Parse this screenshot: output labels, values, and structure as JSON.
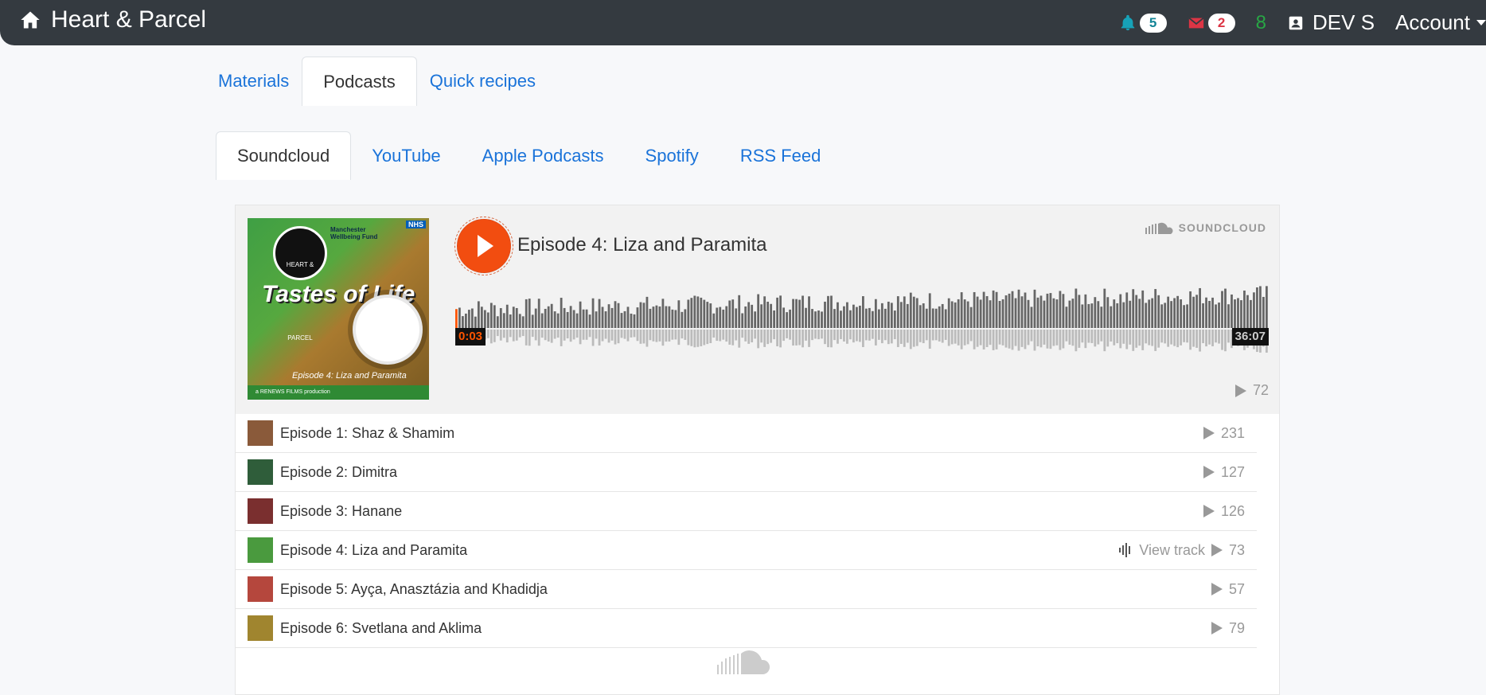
{
  "navbar": {
    "brand": "Heart & Parcel",
    "brand_icon": "home-icon",
    "notifications_count": "5",
    "messages_count": "2",
    "green_count": "8",
    "user_name": "DEV S",
    "account_label": "Account"
  },
  "main_tabs": [
    {
      "label": "Materials",
      "active": false
    },
    {
      "label": "Podcasts",
      "active": true
    },
    {
      "label": "Quick recipes",
      "active": false
    }
  ],
  "podcast_tabs": [
    {
      "label": "Soundcloud",
      "active": true
    },
    {
      "label": "YouTube",
      "active": false
    },
    {
      "label": "Apple Podcasts",
      "active": false
    },
    {
      "label": "Spotify",
      "active": false
    },
    {
      "label": "RSS Feed",
      "active": false
    }
  ],
  "player": {
    "current_track": "Episode 4: Liza and Paramita",
    "brand_label": "SOUNDCLOUD",
    "time_elapsed": "0:03",
    "time_total": "36:07",
    "plays": "72",
    "progress": 0.0014,
    "artwork": {
      "nhs": "NHS",
      "fund": "Manchester Wellbeing Fund",
      "logo": "HEART & PARCEL",
      "title": "Tastes of Life",
      "episode": "Episode 4:",
      "names": "Liza and Paramita",
      "footer": "a RENEWS FILMS production"
    }
  },
  "tracks": [
    {
      "title": "Episode 1: Shaz & Shamim",
      "plays": "231",
      "current": false,
      "thumb_color": "#8a5a3a"
    },
    {
      "title": "Episode 2: Dimitra",
      "plays": "127",
      "current": false,
      "thumb_color": "#2f5d3a"
    },
    {
      "title": "Episode 3: Hanane",
      "plays": "126",
      "current": false,
      "thumb_color": "#7a2f2f"
    },
    {
      "title": "Episode 4: Liza and Paramita",
      "plays": "73",
      "current": true,
      "view_label": "View track",
      "thumb_color": "#4a9a3e"
    },
    {
      "title": "Episode 5: Ayça, Anasztázia and Khadidja",
      "plays": "57",
      "current": false,
      "thumb_color": "#b5473d"
    },
    {
      "title": "Episode 6: Svetlana and Aklima",
      "plays": "79",
      "current": false,
      "thumb_color": "#a0852f"
    }
  ],
  "colors": {
    "navbar": "#343a40",
    "link": "#1a73d9",
    "soundcloud_orange": "#f24d10"
  }
}
